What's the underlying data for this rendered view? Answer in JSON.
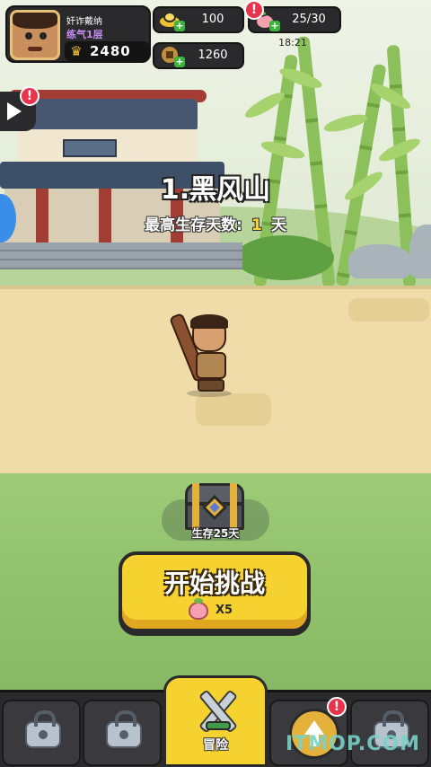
{
  "player": {
    "name": "奸诈戴纳",
    "rank": "练气1层",
    "power": "2480"
  },
  "resources": {
    "gold": "100",
    "coins": "1260",
    "stamina": "25/30",
    "stamina_timer": "18:21"
  },
  "badges": {
    "mark": "!"
  },
  "stage": {
    "title": "1.黑风山",
    "best_label": "最高生存天数:",
    "best_value": "1",
    "best_unit": "天"
  },
  "chest": {
    "label": "生存25天"
  },
  "start": {
    "label": "开始挑战",
    "cost": "X5"
  },
  "nav": {
    "adventure_label": "冒险"
  },
  "watermark": "ITMOP.COM",
  "colors": {
    "accent": "#f6d230",
    "panel": "#2a2a2c",
    "badge": "#e8334c",
    "rank": "#c58cf0"
  }
}
